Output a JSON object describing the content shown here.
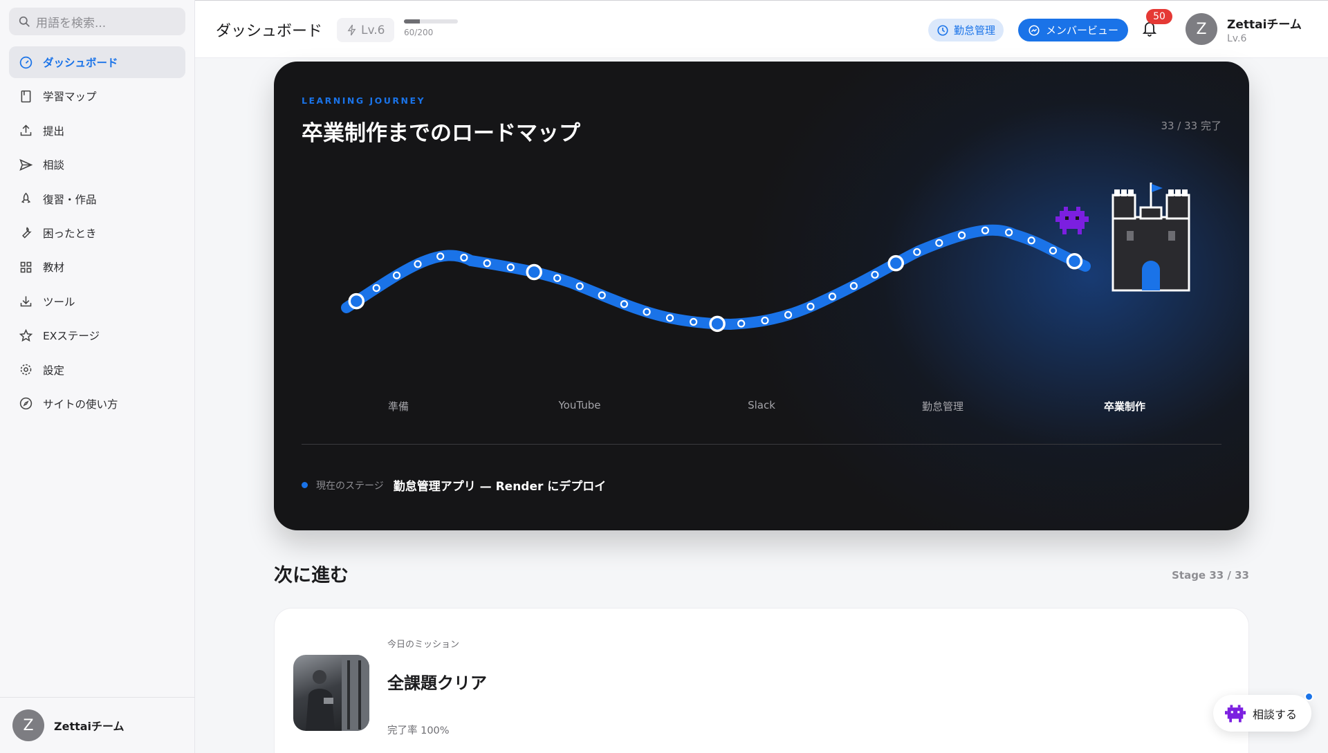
{
  "sidebar": {
    "search_placeholder": "用語を検索...",
    "items": [
      {
        "label": "ダッシュボード",
        "icon": "dashboard-icon"
      },
      {
        "label": "学習マップ",
        "icon": "book-icon"
      },
      {
        "label": "提出",
        "icon": "upload-icon"
      },
      {
        "label": "相談",
        "icon": "send-icon"
      },
      {
        "label": "復習・作品",
        "icon": "rocket-icon"
      },
      {
        "label": "困ったとき",
        "icon": "wrench-icon"
      },
      {
        "label": "教材",
        "icon": "grid-icon"
      },
      {
        "label": "ツール",
        "icon": "download-icon"
      },
      {
        "label": "EXステージ",
        "icon": "star-icon"
      },
      {
        "label": "設定",
        "icon": "gear-icon"
      },
      {
        "label": "サイトの使い方",
        "icon": "compass-icon"
      }
    ],
    "user": {
      "initial": "Z",
      "name": "Zettaiチーム"
    }
  },
  "header": {
    "title": "ダッシュボード",
    "level": "Lv.6",
    "xp_text": "60/200",
    "xp_progress": 0.3,
    "attendance_label": "勤怠管理",
    "member_view_label": "メンバービュー",
    "notification_count": "50",
    "user": {
      "initial": "Z",
      "name": "Zettaiチーム",
      "level": "Lv.6"
    }
  },
  "journey": {
    "kicker": "LEARNING JOURNEY",
    "title": "卒業制作までのロードマップ",
    "count": "33 / 33 完了",
    "stages": [
      "準備",
      "YouTube",
      "Slack",
      "勤怠管理",
      "卒業制作"
    ],
    "current_label": "現在のステージ",
    "current_value": "勤怠管理アプリ — Render にデプロイ",
    "accent": "#1a73e8"
  },
  "next": {
    "title": "次に進む",
    "stage": "Stage 33 / 33"
  },
  "mission": {
    "kicker": "今日のミッション",
    "title": "全課題クリア",
    "rate": "完了率 100%"
  },
  "consult_button": {
    "label": "相談する"
  }
}
